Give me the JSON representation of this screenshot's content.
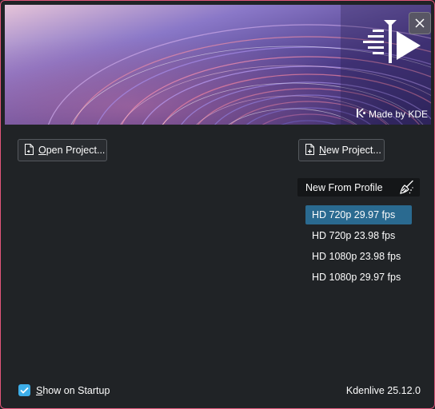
{
  "window": {
    "accent_border": "#e2557a",
    "background": "#202326"
  },
  "banner": {
    "made_by": "Made by KDE",
    "logo_icon": "kdenlive-logo-icon",
    "close_icon": "close-icon",
    "colors": {
      "base": "#3d2f6f",
      "pink": "#e06a8a",
      "violet": "#9a86e0"
    }
  },
  "actions": {
    "open_project_mnemonic": "O",
    "open_project_rest": "pen Project...",
    "new_project_mnemonic": "N",
    "new_project_rest": "ew Project..."
  },
  "profiles": {
    "header": "New From Profile",
    "header_icon": "broom-icon",
    "items": [
      {
        "label": "HD 720p 29.97 fps",
        "selected": true
      },
      {
        "label": "HD 720p 23.98 fps",
        "selected": false
      },
      {
        "label": "HD 1080p 23.98 fps",
        "selected": false
      },
      {
        "label": "HD 1080p 29.97 fps",
        "selected": false
      }
    ]
  },
  "footer": {
    "show_on_startup_mnemonic": "S",
    "show_on_startup_rest": "how on Startup",
    "show_on_startup_checked": true,
    "version": "Kdenlive 25.12.0"
  }
}
